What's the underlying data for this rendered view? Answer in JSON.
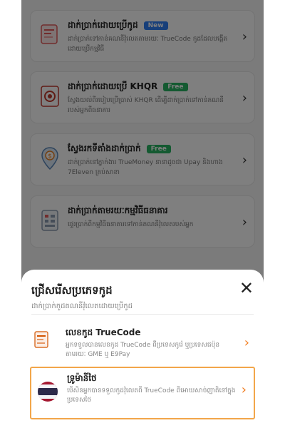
{
  "cards": [
    {
      "title": "ដាក់ប្រាក់ដោយប្រើកូដ",
      "badge": "New",
      "desc": "ដាក់ប្រាក់ទៅកាន់គណនីវ៉ុលេតតាមរយៈ TrueCode កូដដែលបង្កើតដោយប្រើកម្មវិធី"
    },
    {
      "title": "ដាក់ប្រាក់ដោយប្រើ KHQR",
      "badge": "Free",
      "desc": "ស្វែងយល់ពីរបៀបប្រើប្រាស់ KHQR ដើម្បីដាក់ប្រាក់ទៅកាន់គណនីរបស់អ្នកពីធនាគារ"
    },
    {
      "title": "ស្វែងរកទីតាំងដាក់ប្រាក់",
      "badge": "Free",
      "desc": "ដាក់ប្រាក់នៅភ្នាក់ងារ TrueMoney នានាដូចជា Upay និងហាង 7Eleven គ្រប់សាខា"
    },
    {
      "title": "ដាក់ប្រាក់តាមរយៈកម្មវិធីធនាគារ",
      "badge": "",
      "desc": "ផ្ទេរប្រាក់ពីកម្មវិធីធនាគារទៅកាន់គណនីវ៉ុលេតរបស់អ្នក"
    }
  ],
  "sheet": {
    "title": "ជ្រើសរើសប្រភេទកូដ",
    "subtitle": "ដាក់ប្រាក់កូដគណនីវ៉ុលេតដោយប្រើកូដ",
    "close": "✕",
    "options": [
      {
        "title": "លេខកូដ TrueCode",
        "desc": "អ្នកទទួលបានលេខកូដ TrueCode ពីប្រទេសកូរ៉េ ឬប្រទេសជប៉ុន តាមរយៈ GME ឬ E9Pay",
        "chevron": "›"
      },
      {
        "title": "ទ្រូម៉ានីថៃ",
        "desc": "បើសិនអ្នកបានទទួលកូដវ៉ុលេតពី TrueCode ពីអោយសាច់ញាតិនៅក្នុងប្រទេសថៃ",
        "chevron": "›"
      }
    ]
  },
  "chevron": "›",
  "colors": {
    "accent": "#f27c1d",
    "highlight_border": "#f2a64a",
    "badge_new": "#2f7ef5",
    "badge_free": "#28b463"
  }
}
